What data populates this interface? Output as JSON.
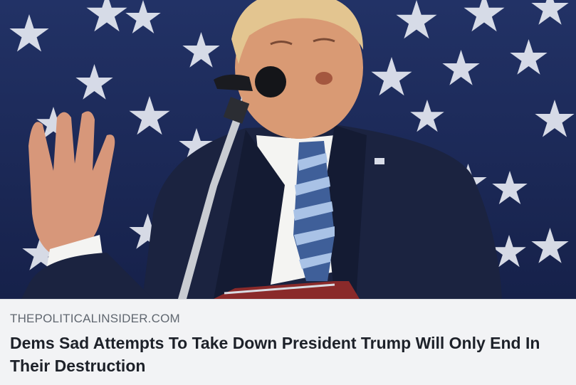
{
  "link_preview": {
    "image_alt": "Trump speaking at a podium in front of a stars backdrop",
    "domain": "THEPOLITICALINSIDER.COM",
    "headline": "Dems Sad Attempts To Take Down President Trump Will Only End In Their Destruction"
  },
  "colors": {
    "backdrop_navy": "#1c2a55",
    "star_white": "#e8ebf3",
    "suit_navy": "#1b2340",
    "tie_blue": "#5b7fb8",
    "caption_bg": "#f2f3f5",
    "headline_text": "#1d2129",
    "domain_text": "#606770"
  }
}
